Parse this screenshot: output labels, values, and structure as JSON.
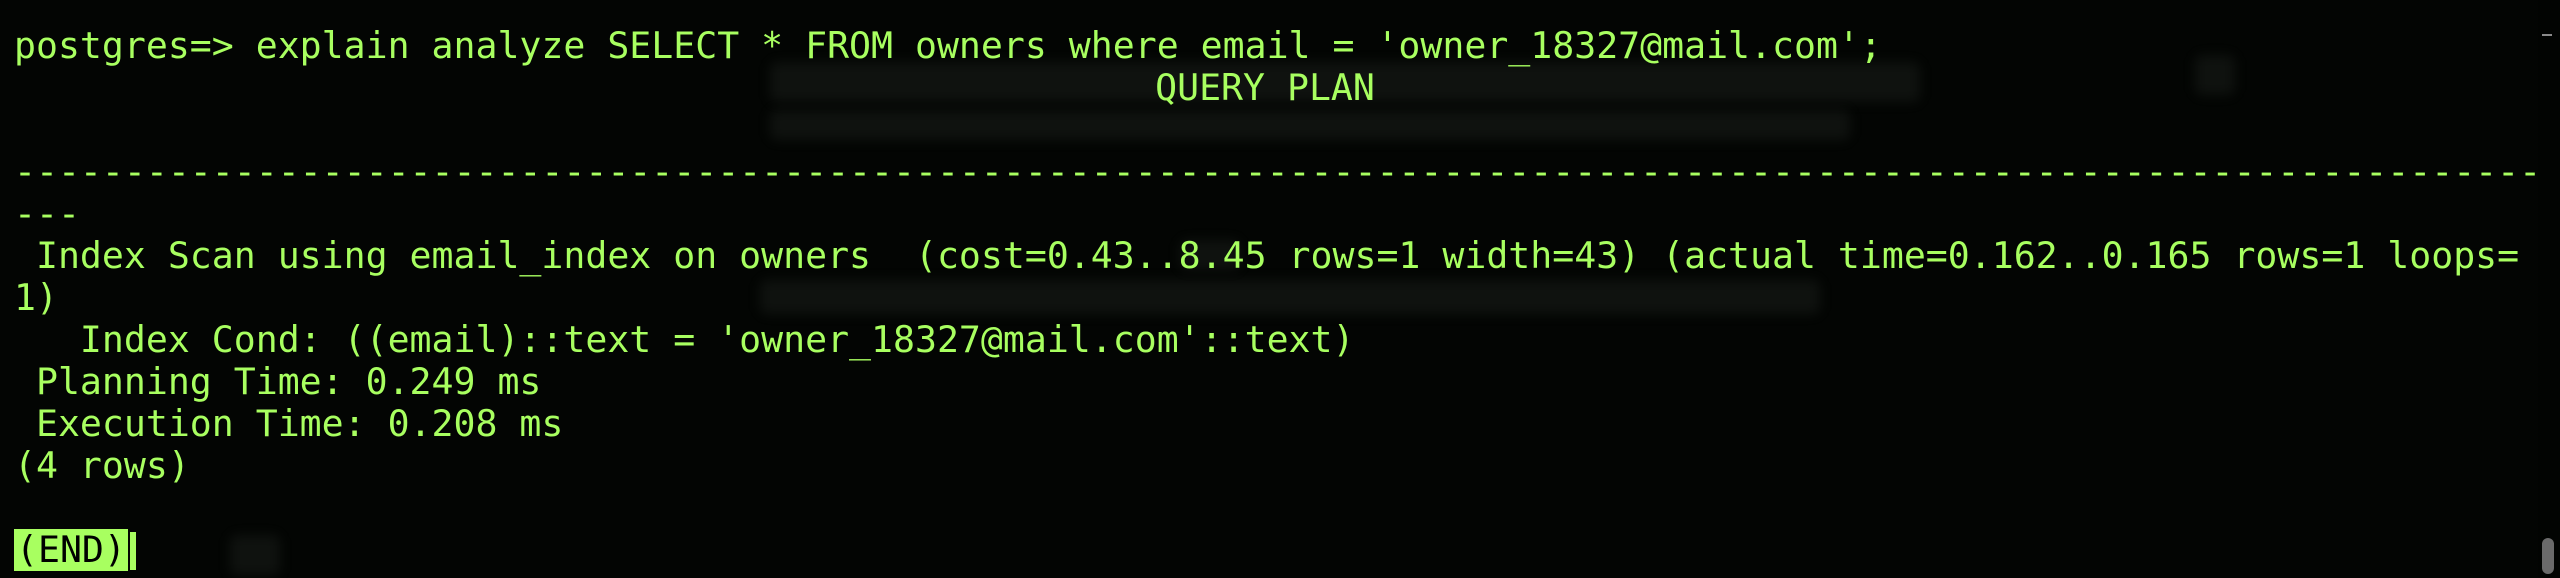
{
  "terminal": {
    "prompt_line": "postgres=> explain analyze SELECT * FROM owners where email = 'owner_18327@mail.com';",
    "header": "QUERY PLAN",
    "separator_1": "-------------------------------------------------------------------------------------------------------------------",
    "separator_2": "---",
    "plan_line_1": " Index Scan using email_index on owners  (cost=0.43..8.45 rows=1 width=43) (actual time=0.162..0.165 rows=1 loops=",
    "plan_line_1_wrap": "1)",
    "plan_line_2": "   Index Cond: ((email)::text = 'owner_18327@mail.com'::text)",
    "planning_time": " Planning Time: 0.249 ms",
    "execution_time": " Execution Time: 0.208 ms",
    "row_count": "(4 rows)",
    "pager_status": "(END)"
  },
  "colors": {
    "background": "#030503",
    "text": "#a8ff60"
  }
}
